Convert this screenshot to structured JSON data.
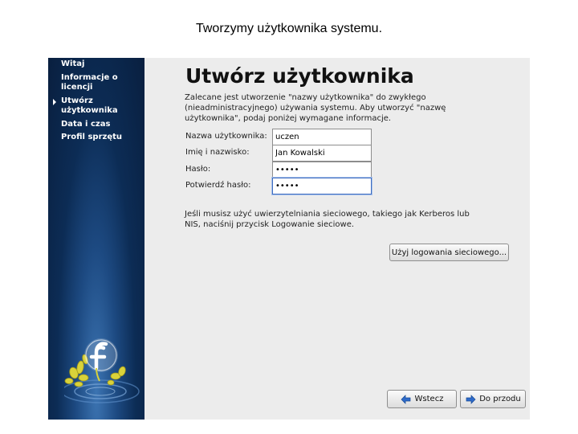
{
  "caption": "Tworzymy użytkownika systemu.",
  "sidebar": {
    "items": [
      {
        "label": "Witaj"
      },
      {
        "label": "Informacje o\nlicencji"
      },
      {
        "label": "Utwórz\nużytkownika",
        "current": true
      },
      {
        "label": "Data i czas"
      },
      {
        "label": "Profil sprzętu"
      }
    ],
    "logo_icon": "fedora-logo-icon"
  },
  "main": {
    "title": "Utwórz użytkownika",
    "intro": "Zalecane jest utworzenie \"nazwy użytkownika\" do zwykłego (nieadministracyjnego) używania systemu. Aby utworzyć \"nazwę użytkownika\", podaj poniżej wymagane informacje.",
    "fields": {
      "username": {
        "label": "Nazwa użytkownika:",
        "value": "uczen"
      },
      "fullname": {
        "label": "Imię i nazwisko:",
        "value": "Jan Kowalski"
      },
      "password": {
        "label": "Hasło:",
        "value": "•••••"
      },
      "confirm": {
        "label": "Potwierdź hasło:",
        "value": "•••••"
      }
    },
    "network_text": "Jeśli musisz użyć uwierzytelniania sieciowego, takiego jak Kerberos lub NIS, naciśnij przycisk Logowanie sieciowe.",
    "network_button": "Użyj logowania sieciowego...",
    "back_button": "Wstecz",
    "forward_button": "Do przodu"
  },
  "colors": {
    "sidebar": "#0c2c55",
    "accent_arrow": "#1f5fbf"
  }
}
